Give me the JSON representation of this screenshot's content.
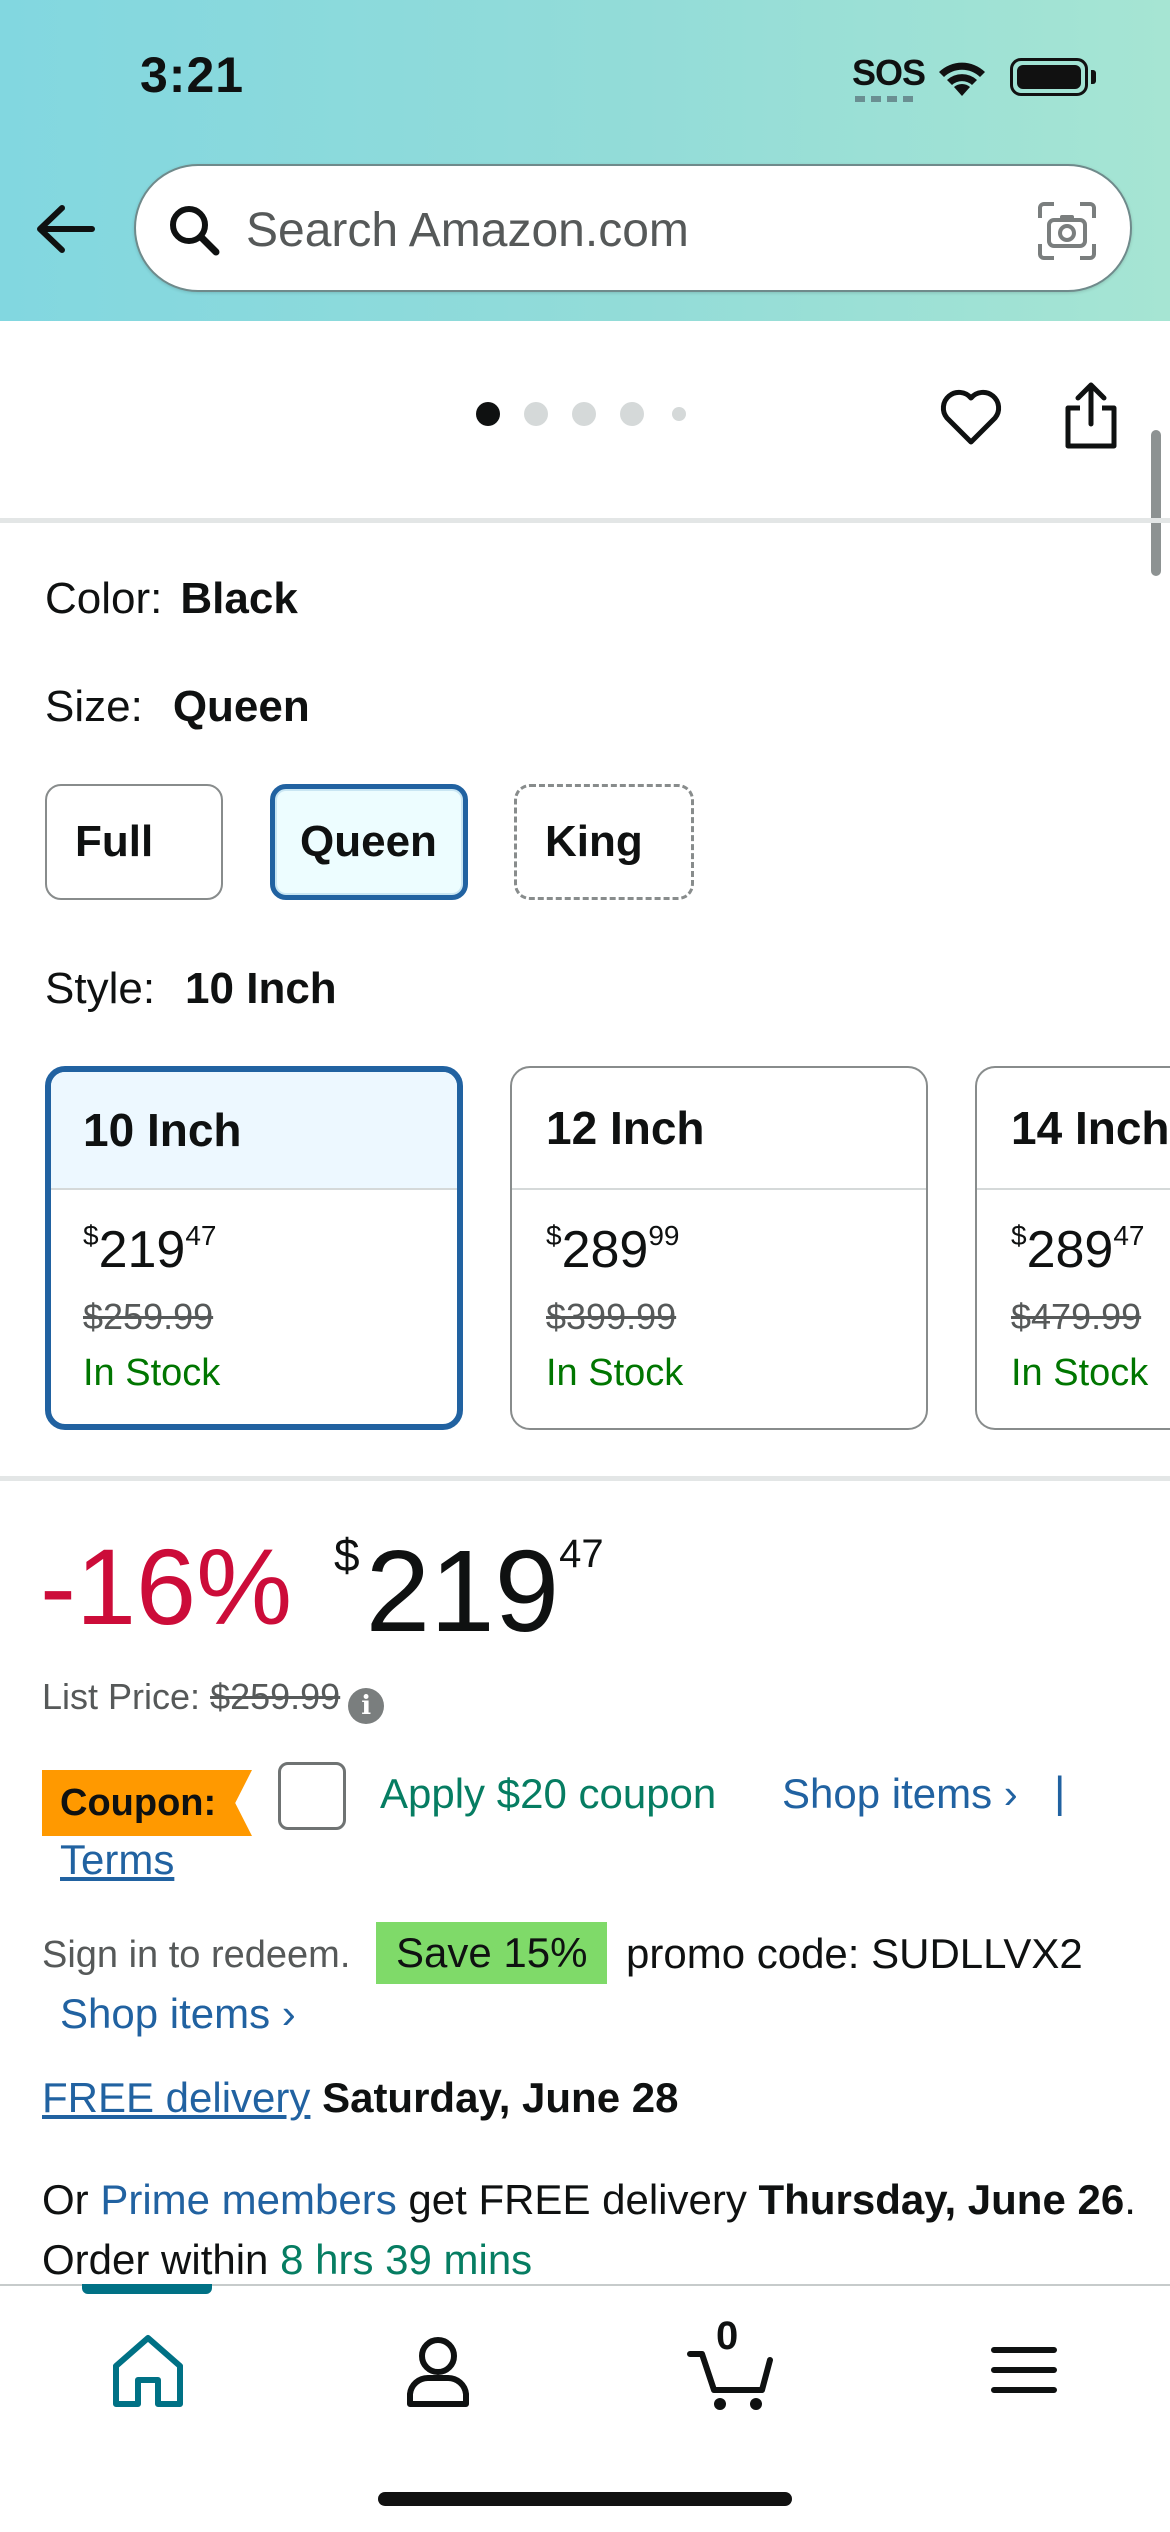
{
  "status_bar": {
    "time": "3:21",
    "sos": "SOS"
  },
  "search": {
    "placeholder": "Search Amazon.com"
  },
  "variations": {
    "color_label": "Color:",
    "color_value": "Black",
    "size_label": "Size:",
    "size_value": "Queen",
    "sizes": [
      "Full",
      "Queen",
      "King"
    ],
    "style_label": "Style:",
    "style_value": "10 Inch",
    "styles": [
      {
        "name": "10 Inch",
        "price_whole": "219",
        "price_cents": "47",
        "list_price": "$259.99",
        "stock": "In Stock"
      },
      {
        "name": "12 Inch",
        "price_whole": "289",
        "price_cents": "99",
        "list_price": "$399.99",
        "stock": "In Stock"
      },
      {
        "name": "14 Inch",
        "price_whole": "289",
        "price_cents": "47",
        "list_price": "$479.99",
        "stock": "In Stock"
      }
    ]
  },
  "pricing": {
    "discount": "-16%",
    "currency": "$",
    "price_whole": "219",
    "price_cents": "47",
    "list_price_label": "List Price:",
    "list_price": "$259.99"
  },
  "coupon": {
    "badge": "Coupon:",
    "apply_text": "Apply $20 coupon",
    "shop_items": "Shop items ›",
    "separator": "|",
    "terms": "Terms"
  },
  "promo": {
    "sign_in": "Sign in to redeem.",
    "save_badge": "Save 15%",
    "code_text": "promo code: SUDLLVX2",
    "shop_items": "Shop items ›"
  },
  "delivery": {
    "free_link": "FREE delivery",
    "date": "Saturday, June 28"
  },
  "prime": {
    "prefix": "Or ",
    "prime_link": "Prime members",
    "middle": " get FREE delivery ",
    "date": "Thursday, June 26",
    "order_within": ". Order within ",
    "countdown": "8 hrs 39 mins"
  },
  "tabbar": {
    "cart_count": "0"
  },
  "colors": {
    "link": "#2162a1",
    "deal_red": "#cc0c39",
    "in_stock_green": "#007600",
    "coupon_orange": "#ff9900",
    "save_green": "#7fda69",
    "selected_border": "#2162a1",
    "tab_accent": "#007185"
  }
}
